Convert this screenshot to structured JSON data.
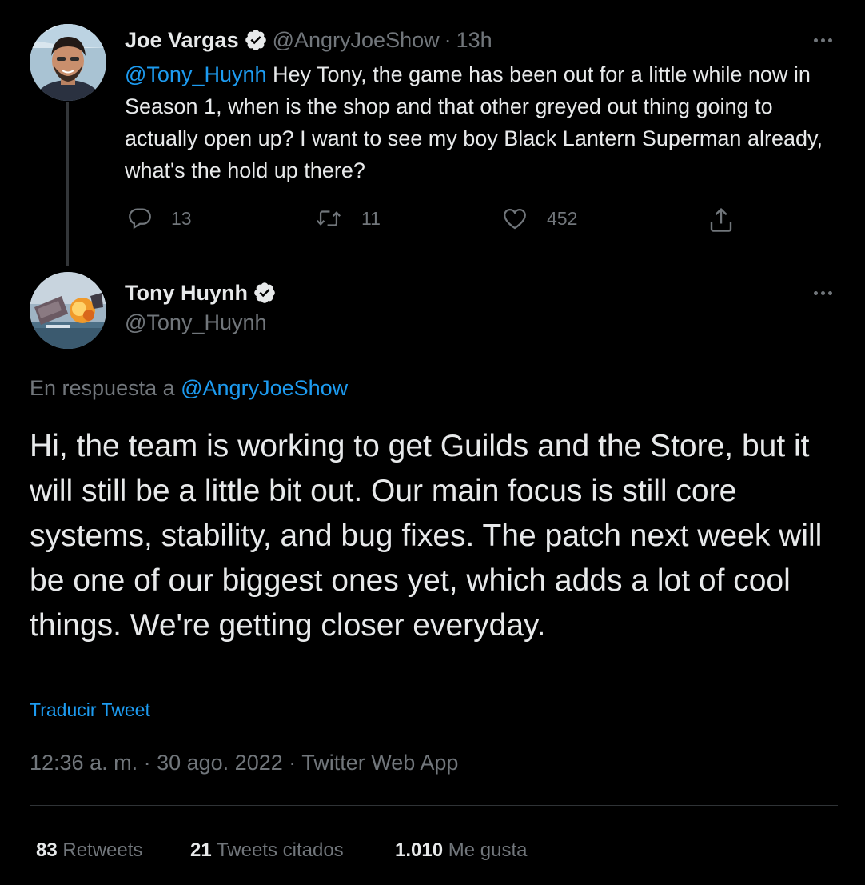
{
  "parent_tweet": {
    "author_name": "Joe Vargas",
    "author_handle": "@AngryJoeShow",
    "separator": "·",
    "time_ago": "13h",
    "mention": "@Tony_Huynh",
    "text": " Hey Tony, the game has been out for a little while now in Season 1, when is the shop and that other greyed out thing going to actually open up? I want to see my boy Black Lantern Superman already, what's the hold up there?",
    "actions": {
      "reply_count": "13",
      "retweet_count": "11",
      "like_count": "452"
    },
    "icons": [
      "reply-icon",
      "retweet-icon",
      "like-icon",
      "share-icon",
      "verified-icon",
      "more-icon"
    ]
  },
  "main_tweet": {
    "author_name": "Tony Huynh",
    "author_handle": "@Tony_Huynh",
    "reply_prefix": "En respuesta a ",
    "reply_to": "@AngryJoeShow",
    "text": "Hi, the team is working to get Guilds and the Store, but it will still be a little bit out. Our main focus is still core systems, stability, and bug fixes. The patch next week will be one of our biggest ones yet, which adds a lot of cool things. We're getting closer everyday.",
    "translate_label": "Traducir Tweet",
    "time": "12:36 a. m.",
    "date": "30 ago. 2022",
    "source": "Twitter Web App",
    "meta_separator": " · ",
    "stats": {
      "retweets_count": "83",
      "retweets_label": "Retweets",
      "quotes_count": "21",
      "quotes_label": "Tweets citados",
      "likes_count": "1.010",
      "likes_label": "Me gusta"
    }
  },
  "colors": {
    "background": "#000000",
    "text_primary": "#e7e9ea",
    "text_secondary": "#71767b",
    "accent": "#1d9bf0",
    "divider": "#2f3336"
  }
}
